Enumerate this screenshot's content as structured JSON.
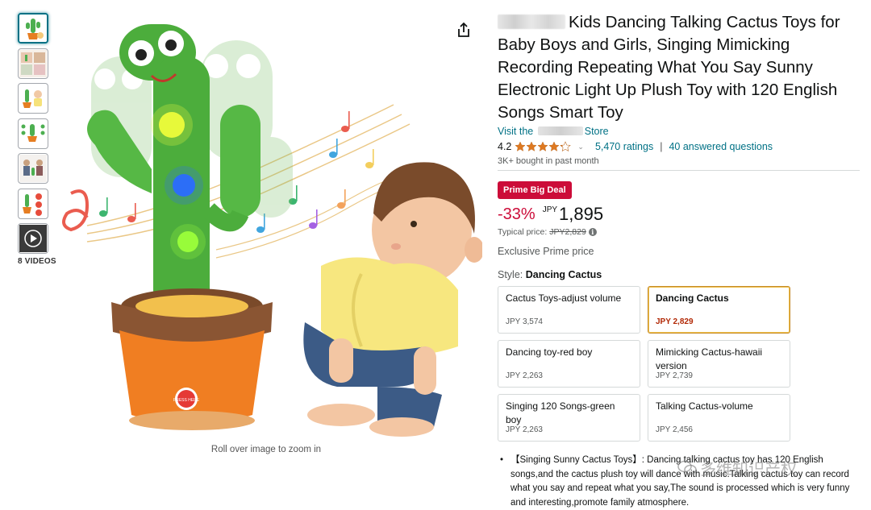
{
  "thumbnails": {
    "items": [
      "thumb-1",
      "thumb-2",
      "thumb-3",
      "thumb-4",
      "thumb-5",
      "thumb-6",
      "thumb-video"
    ],
    "video_label": "8 VIDEOS"
  },
  "main_image": {
    "zoom_hint": "Roll over image to zoom in",
    "toy_button_text": "PRESS HERE"
  },
  "product": {
    "title": "Kids Dancing Talking Cactus Toys for Baby Boys and Girls, Singing Mimicking Recording Repeating What You Say Sunny Electronic Light Up Plush Toy with 120 English Songs Smart Toy",
    "store_prefix": "Visit the",
    "store_suffix": "Store",
    "rating": "4.2",
    "stars_value": 4.2,
    "ratings_count": "5,470 ratings",
    "separator": "|",
    "answered": "40 answered questions",
    "bought": "3K+ bought in past month"
  },
  "pricing": {
    "badge": "Prime Big Deal",
    "discount": "-33%",
    "currency": "JPY",
    "price": "1,895",
    "typical_label": "Typical price:",
    "typical_value": "JPY2,829",
    "exclusive": "Exclusive Prime price"
  },
  "style": {
    "label": "Style:",
    "selected": "Dancing Cactus",
    "options": [
      {
        "name": "Cactus Toys-adjust volume",
        "price": "JPY 3,574"
      },
      {
        "name": "Dancing Cactus",
        "price": "JPY 2,829"
      },
      {
        "name": "Dancing toy-red boy",
        "price": "JPY 2,263"
      },
      {
        "name": "Mimicking Cactus-hawaii version",
        "price": "JPY 2,739"
      },
      {
        "name": "Singing 120 Songs-green boy",
        "price": "JPY 2,263"
      },
      {
        "name": "Talking Cactus-volume",
        "price": "JPY 2,456"
      }
    ]
  },
  "bullets": {
    "dot": "•",
    "first": "【Singing Sunny Cactus Toys】: Dancing talking cactus toy has 120 English songs,and the cactus plush toy will dance with music.Talking cactus toy can record what you say and repeat what you say,The sound is processed which is very funny and interesting,promote family atmosphere."
  },
  "watermark": {
    "text": "多维知识产权"
  },
  "colors": {
    "link": "#007185",
    "deal": "#cc0c39",
    "star": "#de7921",
    "selected_border": "#c48b2a"
  }
}
